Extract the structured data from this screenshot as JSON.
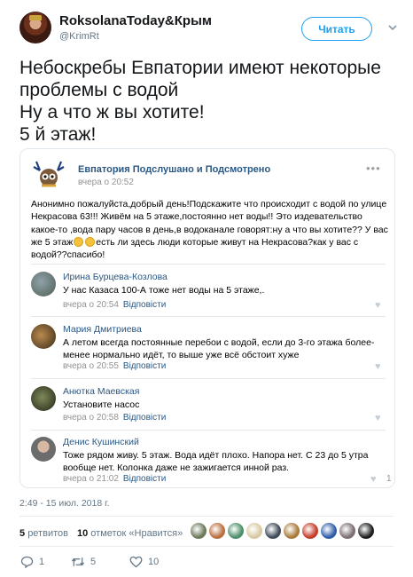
{
  "tweet": {
    "author_name": "RoksolanaToday&Крым",
    "author_handle": "@KrimRt",
    "follow_label": "Читать",
    "text_lines": [
      "Небоскребы Евпатории имеют некоторые",
      "проблемы с водой",
      "Ну а что ж вы хотите!",
      "5 й этаж!"
    ],
    "date": "2:49 - 15 июл. 2018 г.",
    "retweets_count": "5",
    "retweets_label": "ретвитов",
    "likes_count": "10",
    "likes_label": "отметок «Нравится»",
    "actions": {
      "reply_count": "1",
      "retweet_count": "5",
      "like_count": "10"
    },
    "liker_colors": [
      "#6a7a5a",
      "#b96e3f",
      "#4d8f6b",
      "#d8c9a3",
      "#3f4a58",
      "#a87a3b",
      "#c43d2a",
      "#2f5ca8",
      "#7c6f74",
      "#1e1e1e"
    ]
  },
  "vk": {
    "group_name": "Евпатория Подслушано и Подсмотрено",
    "group_time": "вчера о 20:52",
    "post_lines": [
      "Анонимно пожалуйста,добрый день!Подскажите что происходит с водой по улице",
      "Некрасова 63!!! Живём на 5 этаже,постоянно нет воды!! Это издевательство",
      "какое-то ,вода пару часов в день,в водоканале говорят:ну а что вы хотите?? У вас"
    ],
    "post_line4_a": "же 5 этаж",
    "post_line4_b": "есть ли здесь люди которые живут на Некрасова?как у вас с",
    "post_line5": "водой??спасибо!",
    "reply_label": "Відповісти",
    "comments": [
      {
        "name": "Ирина Бурцева-Козлова",
        "lines": [
          "У нас Казаса 100-А тоже нет воды на 5 этаже,."
        ],
        "time": "вчера о 20:54",
        "likes": ""
      },
      {
        "name": "Мария Дмитриева",
        "lines": [
          "А летом всегда постоянные перебои с водой, если до 3-го этажа более-",
          "менее нормально идёт, то выше уже всё обстоит хуже"
        ],
        "time": "вчера о 20:55",
        "likes": ""
      },
      {
        "name": "Анютка Маевская",
        "lines": [
          "Установите насос"
        ],
        "time": "вчера о 20:58",
        "likes": ""
      },
      {
        "name": "Денис Кушинский",
        "lines": [
          "Тоже рядом живу. 5 этаж. Вода идёт плохо. Напора нет. С 23 до 5 утра",
          "вообще нет. Колонка даже не зажигается инной раз."
        ],
        "time": "вчера о 21:02",
        "likes": "1"
      }
    ]
  }
}
